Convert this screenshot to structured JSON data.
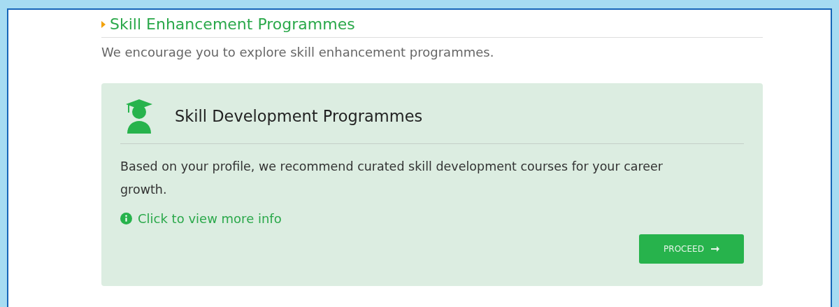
{
  "section": {
    "title": "Skill Enhancement Programmes",
    "intro": "We encourage you to explore skill enhancement programmes."
  },
  "card": {
    "title": "Skill Development Programmes",
    "description": "Based on your profile, we recommend curated skill development courses for your career growth.",
    "info_link": "Click to view more info",
    "button": "PROCEED"
  }
}
